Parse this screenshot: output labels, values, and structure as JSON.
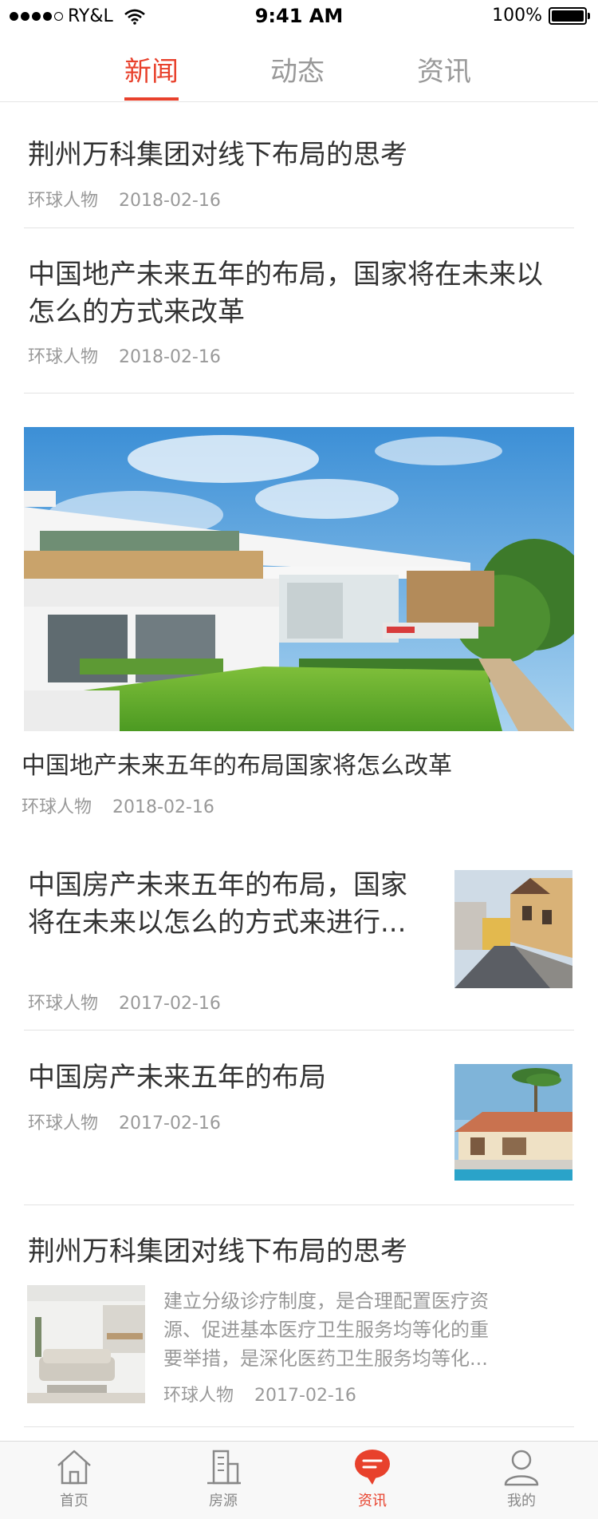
{
  "status_bar": {
    "carrier": "RY&L",
    "time": "9:41 AM",
    "battery": "100%"
  },
  "tabs": [
    {
      "label": "新闻",
      "active": true
    },
    {
      "label": "动态",
      "active": false
    },
    {
      "label": "资讯",
      "active": false
    }
  ],
  "articles": [
    {
      "title": "荆州万科集团对线下布局的思考",
      "source": "环球人物",
      "date": "2018-02-16"
    },
    {
      "title_line1": "中国地产未来五年的布局，国家将在未来以",
      "title_line2": "怎么的方式来改革",
      "source": "环球人物",
      "date": "2018-02-16"
    },
    {
      "title": "中国地产未来五年的布局国家将怎么改革",
      "source": "环球人物",
      "date": "2018-02-16",
      "image": "villa-photo"
    },
    {
      "title_line1": "中国房产未来五年的布局，国家",
      "title_line2": "将在未来以怎么的方式来进行...",
      "source": "环球人物",
      "date": "2017-02-16",
      "image": "street-photo"
    },
    {
      "title": "中国房产未来五年的布局",
      "source": "环球人物",
      "date": "2017-02-16",
      "image": "resort-photo"
    },
    {
      "title": "荆州万科集团对线下布局的思考",
      "desc_line1": "建立分级诊疗制度，是合理配置医疗资",
      "desc_line2": "源、促进基本医疗卫生服务均等化的重",
      "desc_line3": "要举措，是深化医药卫生服务均等化...",
      "source": "环球人物",
      "date": "2017-02-16",
      "image": "living-room-photo"
    }
  ],
  "tab_bar": [
    {
      "label": "首页",
      "icon": "home-icon",
      "active": false
    },
    {
      "label": "房源",
      "icon": "building-icon",
      "active": false
    },
    {
      "label": "资讯",
      "icon": "chat-bubble-icon",
      "active": true
    },
    {
      "label": "我的",
      "icon": "user-icon",
      "active": false
    }
  ],
  "colors": {
    "accent": "#e8412c",
    "text": "#333333",
    "muted": "#999999"
  }
}
